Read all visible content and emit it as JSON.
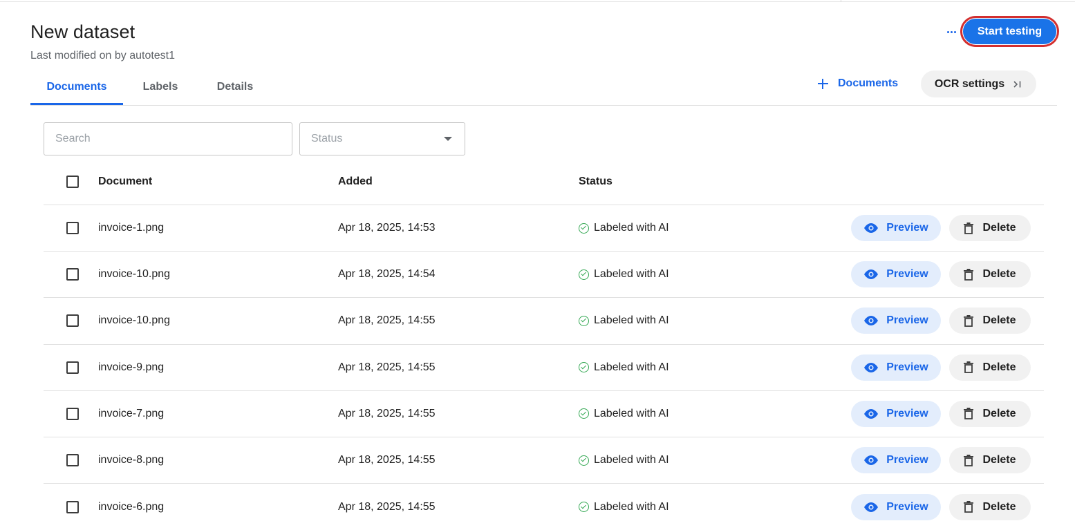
{
  "header": {
    "title": "New dataset",
    "subtitle": "Last modified on by autotest1",
    "more_label": "...",
    "start_label": "Start testing"
  },
  "tabs": [
    {
      "label": "Documents",
      "active": true
    },
    {
      "label": "Labels",
      "active": false
    },
    {
      "label": "Details",
      "active": false
    }
  ],
  "actions": {
    "add_documents_label": "Documents",
    "ocr_settings_label": "OCR settings",
    "ocr_chevron": ">|"
  },
  "filters": {
    "search_placeholder": "Search",
    "status_placeholder": "Status"
  },
  "table": {
    "columns": [
      "Document",
      "Added",
      "Status"
    ],
    "preview_label": "Preview",
    "delete_label": "Delete",
    "rows": [
      {
        "document": "invoice-1.png",
        "added": "Apr 18, 2025, 14:53",
        "status": "Labeled with AI"
      },
      {
        "document": "invoice-10.png",
        "added": "Apr 18, 2025, 14:54",
        "status": "Labeled with AI"
      },
      {
        "document": "invoice-10.png",
        "added": "Apr 18, 2025, 14:55",
        "status": "Labeled with AI"
      },
      {
        "document": "invoice-9.png",
        "added": "Apr 18, 2025, 14:55",
        "status": "Labeled with AI"
      },
      {
        "document": "invoice-7.png",
        "added": "Apr 18, 2025, 14:55",
        "status": "Labeled with AI"
      },
      {
        "document": "invoice-8.png",
        "added": "Apr 18, 2025, 14:55",
        "status": "Labeled with AI"
      },
      {
        "document": "invoice-6.png",
        "added": "Apr 18, 2025, 14:55",
        "status": "Labeled with AI"
      }
    ]
  },
  "colors": {
    "accent": "#1a73e8",
    "focus_ring": "#d32f2f",
    "success": "#34a853",
    "preview_bg": "#e3edfc",
    "delete_bg": "#f1f1f1"
  },
  "icons": {
    "more": "more-horizontal-icon",
    "add": "plus-icon",
    "panel": "chevron-right-bar-icon",
    "dropdown": "caret-down-icon",
    "status": "check-circle-icon",
    "preview": "eye-icon",
    "delete": "trash-icon"
  }
}
